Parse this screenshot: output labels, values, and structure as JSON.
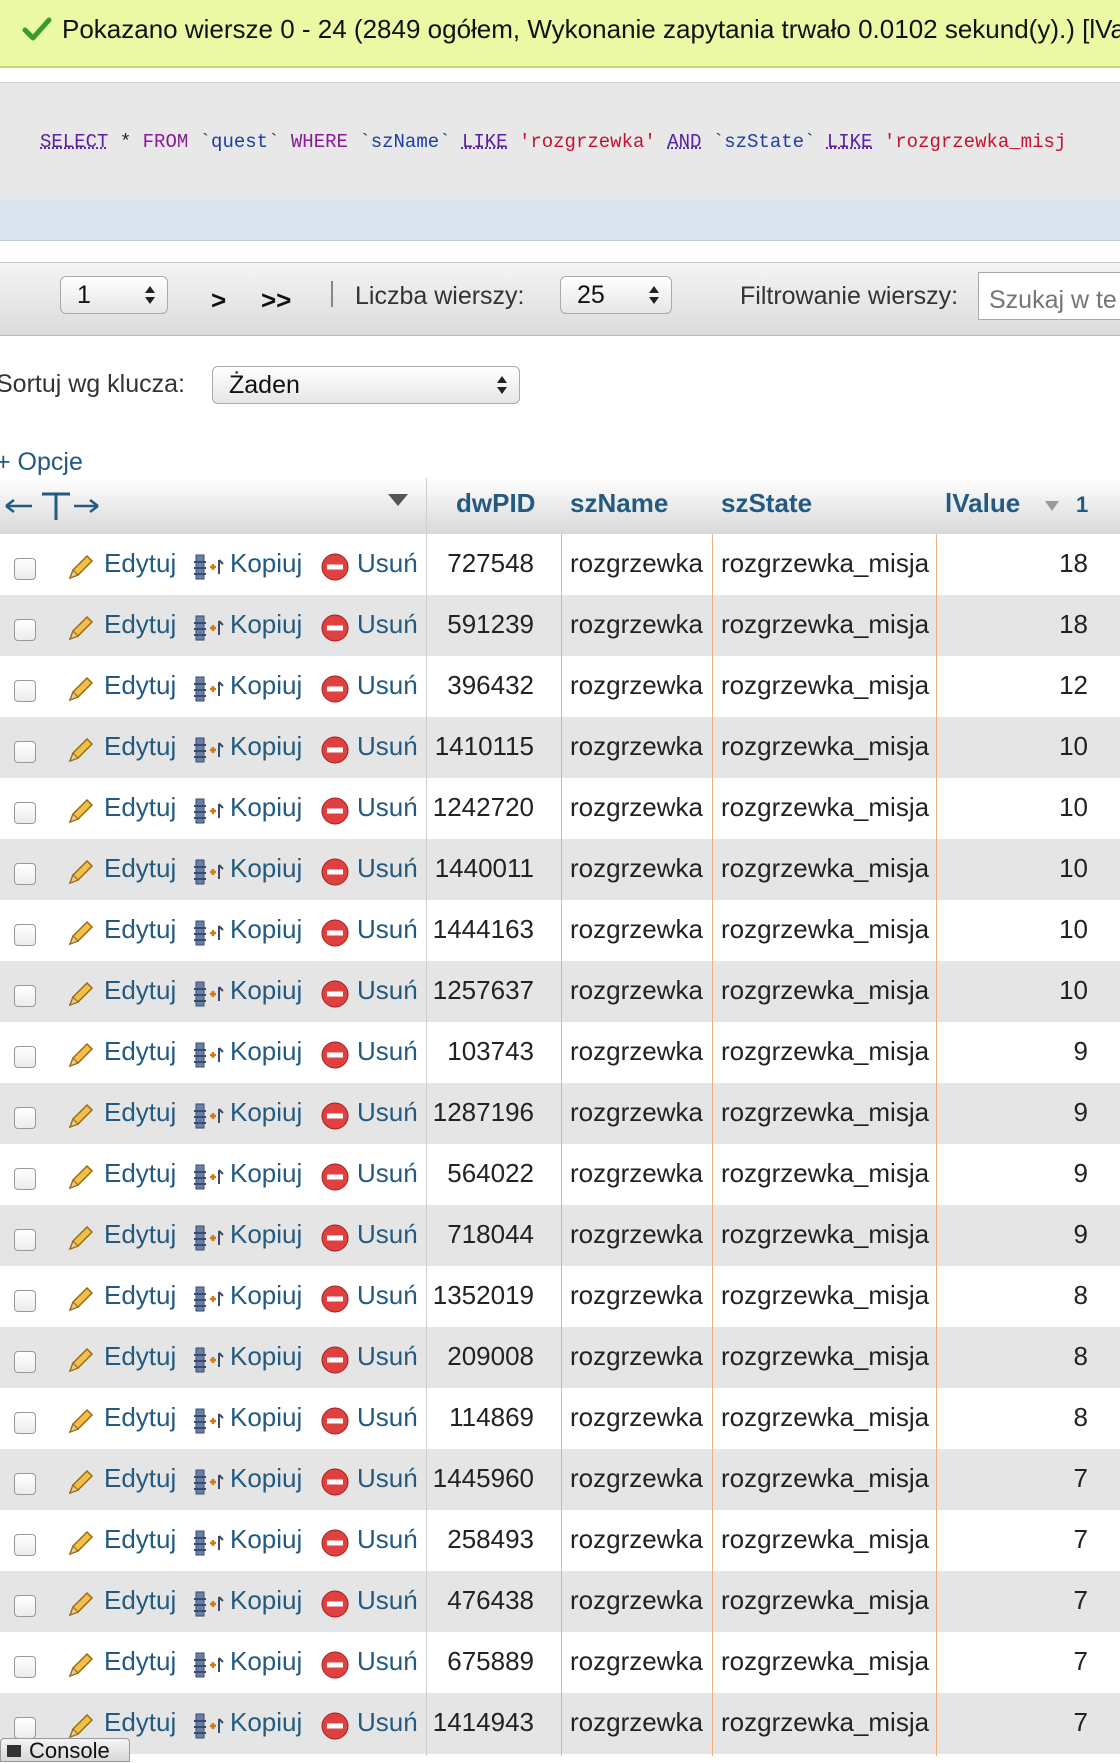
{
  "banner": {
    "message": "Pokazano wiersze 0 - 24 (2849 ogółem, Wykonanie zapytania trwało 0.0102 sekund(y).) [lVa"
  },
  "sql": {
    "tokens": [
      {
        "t": "SELECT",
        "c": "kw-u"
      },
      {
        "t": " * ",
        "c": "plain"
      },
      {
        "t": "FROM",
        "c": "kw-p"
      },
      {
        "t": " ",
        "c": "plain"
      },
      {
        "t": "`quest`",
        "c": "ident"
      },
      {
        "t": " ",
        "c": "plain"
      },
      {
        "t": "WHERE",
        "c": "kw-p"
      },
      {
        "t": " ",
        "c": "plain"
      },
      {
        "t": "`szName`",
        "c": "ident"
      },
      {
        "t": " ",
        "c": "plain"
      },
      {
        "t": "LIKE",
        "c": "kw-u"
      },
      {
        "t": " ",
        "c": "plain"
      },
      {
        "t": "'rozgrzewka'",
        "c": "str"
      },
      {
        "t": " ",
        "c": "plain"
      },
      {
        "t": "AND",
        "c": "kw-u"
      },
      {
        "t": " ",
        "c": "plain"
      },
      {
        "t": "`szState`",
        "c": "ident"
      },
      {
        "t": " ",
        "c": "plain"
      },
      {
        "t": "LIKE",
        "c": "kw-u"
      },
      {
        "t": " ",
        "c": "plain"
      },
      {
        "t": "'rozgrzewka_misj",
        "c": "str"
      }
    ]
  },
  "nav": {
    "page_value": "1",
    "next_label": ">",
    "last_label": ">>",
    "rows_label": "Liczba wierszy:",
    "rows_value": "25",
    "filter_label": "Filtrowanie wierszy:",
    "search_placeholder": "Szukaj w te",
    "sort_label": "Sortuj wg klucza:",
    "sort_value": "Żaden",
    "options_label": "+ Opcje"
  },
  "table": {
    "columns": [
      "dwPID",
      "szName",
      "szState",
      "lValue"
    ],
    "sort_order_indicator": "1",
    "actions": {
      "edit": "Edytuj",
      "copy": "Kopiuj",
      "delete": "Usuń"
    },
    "rows": [
      [
        "727548",
        "rozgrzewka",
        "rozgrzewka_misja",
        "18"
      ],
      [
        "591239",
        "rozgrzewka",
        "rozgrzewka_misja",
        "18"
      ],
      [
        "396432",
        "rozgrzewka",
        "rozgrzewka_misja",
        "12"
      ],
      [
        "1410115",
        "rozgrzewka",
        "rozgrzewka_misja",
        "10"
      ],
      [
        "1242720",
        "rozgrzewka",
        "rozgrzewka_misja",
        "10"
      ],
      [
        "1440011",
        "rozgrzewka",
        "rozgrzewka_misja",
        "10"
      ],
      [
        "1444163",
        "rozgrzewka",
        "rozgrzewka_misja",
        "10"
      ],
      [
        "1257637",
        "rozgrzewka",
        "rozgrzewka_misja",
        "10"
      ],
      [
        "103743",
        "rozgrzewka",
        "rozgrzewka_misja",
        "9"
      ],
      [
        "1287196",
        "rozgrzewka",
        "rozgrzewka_misja",
        "9"
      ],
      [
        "564022",
        "rozgrzewka",
        "rozgrzewka_misja",
        "9"
      ],
      [
        "718044",
        "rozgrzewka",
        "rozgrzewka_misja",
        "9"
      ],
      [
        "1352019",
        "rozgrzewka",
        "rozgrzewka_misja",
        "8"
      ],
      [
        "209008",
        "rozgrzewka",
        "rozgrzewka_misja",
        "8"
      ],
      [
        "114869",
        "rozgrzewka",
        "rozgrzewka_misja",
        "8"
      ],
      [
        "1445960",
        "rozgrzewka",
        "rozgrzewka_misja",
        "7"
      ],
      [
        "258493",
        "rozgrzewka",
        "rozgrzewka_misja",
        "7"
      ],
      [
        "476438",
        "rozgrzewka",
        "rozgrzewka_misja",
        "7"
      ],
      [
        "675889",
        "rozgrzewka",
        "rozgrzewka_misja",
        "7"
      ],
      [
        "1414943",
        "rozgrzewka",
        "rozgrzewka_misja",
        "7"
      ]
    ]
  },
  "console": {
    "label": "Console"
  }
}
